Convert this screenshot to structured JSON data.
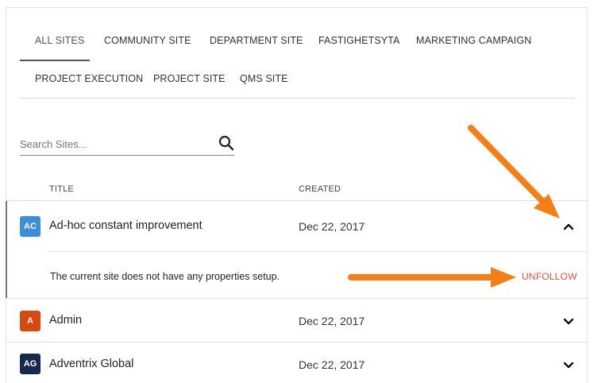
{
  "tabs": [
    {
      "label": "ALL SITES",
      "active": true
    },
    {
      "label": "COMMUNITY SITE"
    },
    {
      "label": "DEPARTMENT SITE"
    },
    {
      "label": "FASTIGHETSYTA"
    },
    {
      "label": "MARKETING CAMPAIGN"
    },
    {
      "label": "PROJECT EXECUTION"
    },
    {
      "label": "PROJECT SITE"
    },
    {
      "label": "QMS SITE"
    }
  ],
  "search": {
    "placeholder": "Search Sites..."
  },
  "table": {
    "headers": {
      "title": "TITLE",
      "created": "CREATED"
    },
    "rows": [
      {
        "initials": "AC",
        "title": "Ad-hoc constant improvement",
        "created": "Dec 22, 2017",
        "color": "#3a8fd6",
        "expanded": true
      },
      {
        "initials": "A",
        "title": "Admin",
        "created": "Dec 22, 2017",
        "color": "#d9480f"
      },
      {
        "initials": "AG",
        "title": "Adventrix Global",
        "created": "Dec 22, 2017",
        "color": "#17284d"
      }
    ],
    "expanded_detail": {
      "message": "The current site does not have any properties setup.",
      "action_label": "UNFOLLOW"
    }
  },
  "colors": {
    "accent_arrow": "#f57f17",
    "unfollow": "#e8503a"
  }
}
